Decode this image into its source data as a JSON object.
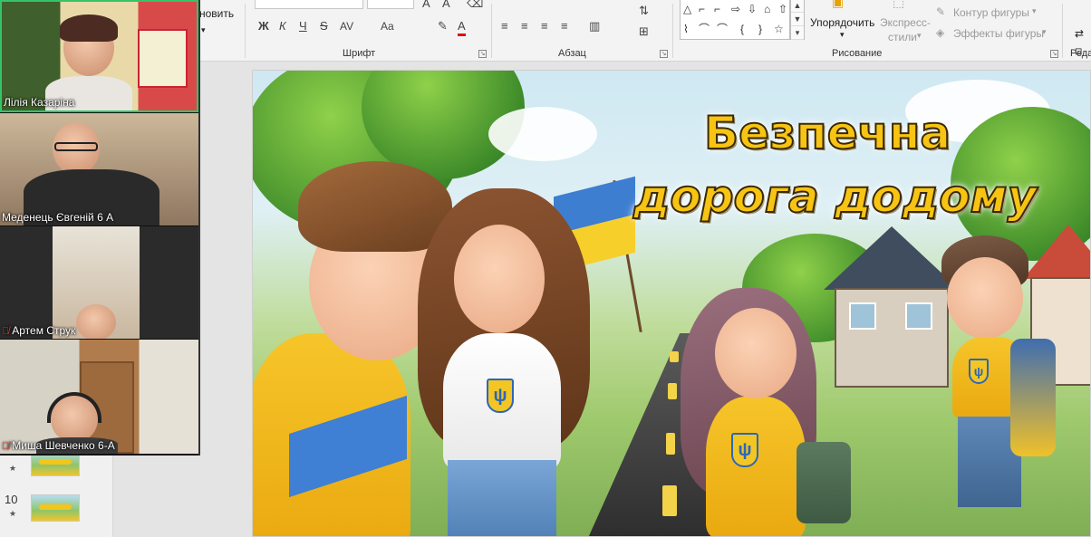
{
  "ribbon": {
    "cut_text": "новить",
    "font_buttons": [
      "Ж",
      "К",
      "Ч",
      "S",
      "AV",
      "Aa",
      "A"
    ],
    "font_group_label": "Шрифт",
    "paragraph_group_label": "Абзац",
    "drawing_group_label": "Рисование",
    "editing_group_label": "Реда",
    "arrange_label": "Упорядочить",
    "quick_styles_label_1": "Экспресс-",
    "quick_styles_label_2": "стили",
    "shape_outline_label": "Контур фигуры",
    "shape_effects_label": "Эффекты фигуры",
    "shapes": [
      "△",
      "⌐",
      "⌐",
      "⇨",
      "⇩",
      "⌂",
      "⇧",
      "⌇",
      "⌒",
      "⌒",
      "{",
      "}",
      "☆"
    ]
  },
  "slides_panel": {
    "items": [
      {
        "number": "",
        "star": "★"
      },
      {
        "number": "10",
        "star": "★"
      }
    ]
  },
  "slide": {
    "title_line1": "Безпечна",
    "title_line2": "дорога додому"
  },
  "videos": [
    {
      "name": "Лілія Казаріна",
      "muted": false,
      "active": true
    },
    {
      "name": "Меденець Євгеній 6 А",
      "muted": false,
      "active": false
    },
    {
      "name": "Артем Струк",
      "muted": true,
      "active": false
    },
    {
      "name": "Миша Шевченко 6-А",
      "muted": true,
      "active": false
    }
  ],
  "colors": {
    "title_fill": "#f7c414",
    "active_speaker": "#34c46a",
    "muted_mic": "#e53935"
  }
}
